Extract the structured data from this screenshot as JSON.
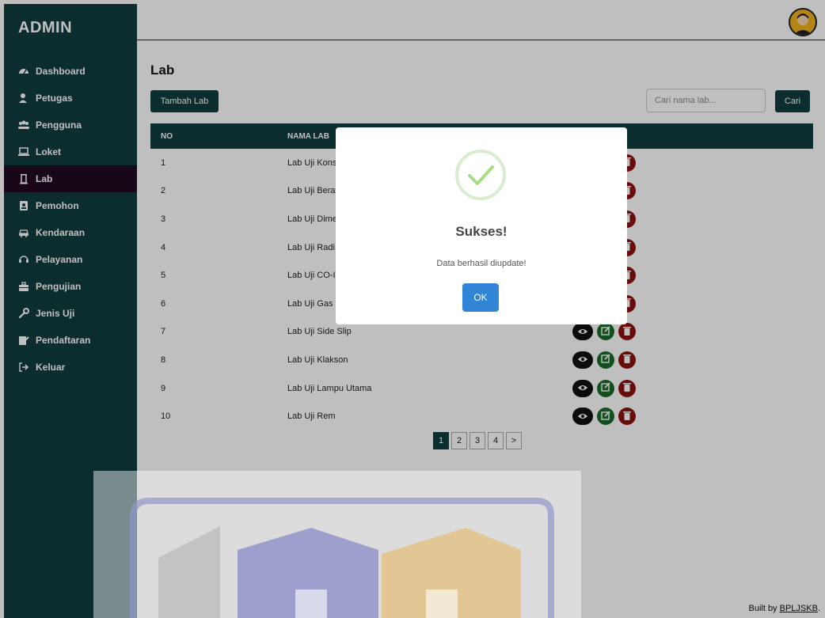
{
  "sidebar": {
    "brand": "ADMIN",
    "items": [
      {
        "label": "Dashboard",
        "icon": "dashboard-icon"
      },
      {
        "label": "Petugas",
        "icon": "user-tie-icon"
      },
      {
        "label": "Pengguna",
        "icon": "users-icon"
      },
      {
        "label": "Loket",
        "icon": "laptop-icon"
      },
      {
        "label": "Lab",
        "icon": "flask-icon",
        "active": true
      },
      {
        "label": "Pemohon",
        "icon": "address-book-icon"
      },
      {
        "label": "Kendaraan",
        "icon": "car-icon"
      },
      {
        "label": "Pelayanan",
        "icon": "headset-icon"
      },
      {
        "label": "Pengujian",
        "icon": "toolbox-icon"
      },
      {
        "label": "Jenis Uji",
        "icon": "wrench-icon"
      },
      {
        "label": "Pendaftaran",
        "icon": "signature-icon"
      },
      {
        "label": "Keluar",
        "icon": "sign-out-icon"
      }
    ]
  },
  "header": {
    "avatar_icon": "user-avatar-icon"
  },
  "main": {
    "title": "Lab",
    "add_button": "Tambah Lab",
    "search_placeholder": "Cari nama lab...",
    "search_button": "Cari",
    "table": {
      "headers": [
        "NO",
        "NAMA LAB"
      ],
      "rows": [
        {
          "no": "1",
          "name": "Lab Uji Kons"
        },
        {
          "no": "2",
          "name": "Lab Uji Berat"
        },
        {
          "no": "3",
          "name": "Lab Uji Dime"
        },
        {
          "no": "4",
          "name": "Lab Uji Radi"
        },
        {
          "no": "5",
          "name": "Lab Uji CO-I"
        },
        {
          "no": "6",
          "name": "Lab Uji Gas"
        },
        {
          "no": "7",
          "name": "Lab Uji Side Slip"
        },
        {
          "no": "8",
          "name": "Lab Uji Klakson"
        },
        {
          "no": "9",
          "name": "Lab Uji Lampu Utama"
        },
        {
          "no": "10",
          "name": "Lab Uji Rem"
        }
      ]
    },
    "pagination": [
      "1",
      "2",
      "3",
      "4",
      ">"
    ],
    "current_page": "1"
  },
  "footer": {
    "prefix": "Built by ",
    "link": "BPLJSKB",
    "suffix": "."
  },
  "modal": {
    "title": "Sukses!",
    "message": "Data berhasil diupdate!",
    "ok_button": "OK"
  },
  "colors": {
    "primary": "#0f3d3e",
    "active_menu": "#1f0a1f",
    "view": "#111111",
    "edit": "#1a6b2b",
    "delete": "#8b1010",
    "success": "#a5dc86",
    "ok_button": "#3085d6"
  }
}
